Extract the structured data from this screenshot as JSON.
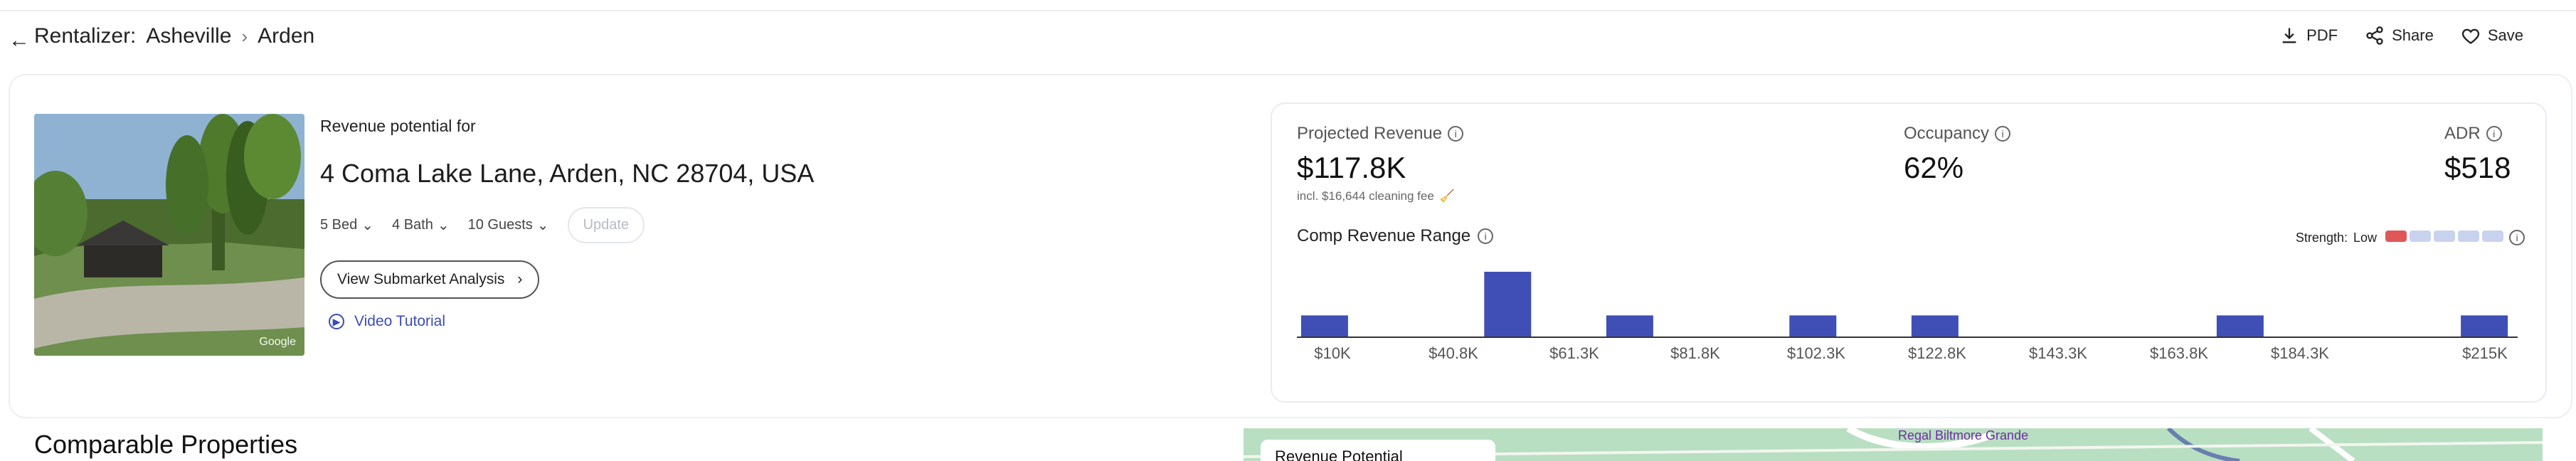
{
  "header": {
    "back_icon": "back-arrow-icon",
    "crumbs": {
      "root": "Rentalizer:",
      "market": "Asheville",
      "submarket": "Arden"
    },
    "actions": {
      "pdf": "PDF",
      "share": "Share",
      "save": "Save"
    }
  },
  "property": {
    "revenue_label": "Revenue potential for",
    "address": "4 Coma Lake Lane, Arden, NC 28704, USA",
    "beds": "5 Bed",
    "baths": "4 Bath",
    "guests": "10 Guests",
    "update_button": "Update",
    "submarket_button": "View Submarket Analysis",
    "video_tutorial": "Video Tutorial",
    "photo_credit": "Google"
  },
  "metrics": {
    "projected_revenue_label": "Projected Revenue",
    "projected_revenue_value": "$117.8K",
    "cleaning_note": "incl. $16,644 cleaning fee",
    "occupancy_label": "Occupancy",
    "occupancy_value": "62%",
    "adr_label": "ADR",
    "adr_value": "$518"
  },
  "comp_range": {
    "label": "Comp Revenue Range",
    "strength_label": "Strength:",
    "strength_value": "Low",
    "strength_level": 1,
    "strength_total": 5,
    "ticks": [
      "$10K",
      "$40.8K",
      "$61.3K",
      "$81.8K",
      "$102.3K",
      "$122.8K",
      "$143.3K",
      "$163.8K",
      "$184.3K",
      "$215K"
    ],
    "bars": [
      1,
      0,
      0,
      3,
      0,
      1,
      0,
      0,
      1,
      0,
      1,
      0,
      0,
      0,
      0,
      1,
      0,
      0,
      0,
      1
    ],
    "bar_color": "#3f4fb5"
  },
  "comparables": {
    "title": "Comparable Properties"
  },
  "map": {
    "card_text": "Revenue Potential",
    "poi": "Regal Biltmore Grande"
  }
}
